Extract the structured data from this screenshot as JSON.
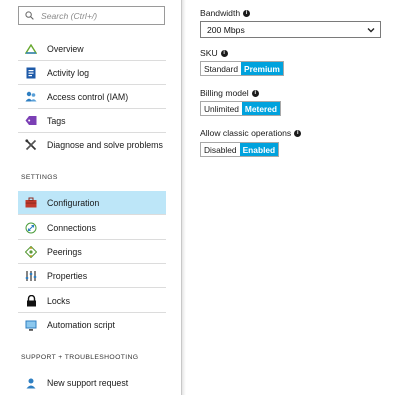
{
  "search": {
    "placeholder": "Search (Ctrl+/)"
  },
  "nav": {
    "top_items": [
      {
        "label": "Overview",
        "icon": "overview-icon"
      },
      {
        "label": "Activity log",
        "icon": "activity-log-icon"
      },
      {
        "label": "Access control (IAM)",
        "icon": "access-control-icon"
      },
      {
        "label": "Tags",
        "icon": "tag-icon"
      },
      {
        "label": "Diagnose and solve problems",
        "icon": "diagnose-tools-icon"
      }
    ],
    "settings_heading": "SETTINGS",
    "settings_items": [
      {
        "label": "Configuration",
        "icon": "toolbox-icon",
        "active": true
      },
      {
        "label": "Connections",
        "icon": "connections-icon"
      },
      {
        "label": "Peerings",
        "icon": "peerings-icon"
      },
      {
        "label": "Properties",
        "icon": "properties-icon"
      },
      {
        "label": "Locks",
        "icon": "lock-icon"
      },
      {
        "label": "Automation script",
        "icon": "automation-script-icon"
      }
    ],
    "support_heading": "SUPPORT + TROUBLESHOOTING",
    "support_items": [
      {
        "label": "New support request",
        "icon": "support-request-icon"
      }
    ]
  },
  "config": {
    "bandwidth": {
      "label": "Bandwidth",
      "value": "200 Mbps"
    },
    "sku": {
      "label": "SKU",
      "options": [
        "Standard",
        "Premium"
      ],
      "selected": "Premium"
    },
    "billing": {
      "label": "Billing model",
      "options": [
        "Unlimited",
        "Metered"
      ],
      "selected": "Metered"
    },
    "classic": {
      "label": "Allow classic operations",
      "options": [
        "Disabled",
        "Enabled"
      ],
      "selected": "Enabled"
    }
  },
  "colors": {
    "accent": "#00a2dd",
    "active_nav": "#bde6f8"
  }
}
